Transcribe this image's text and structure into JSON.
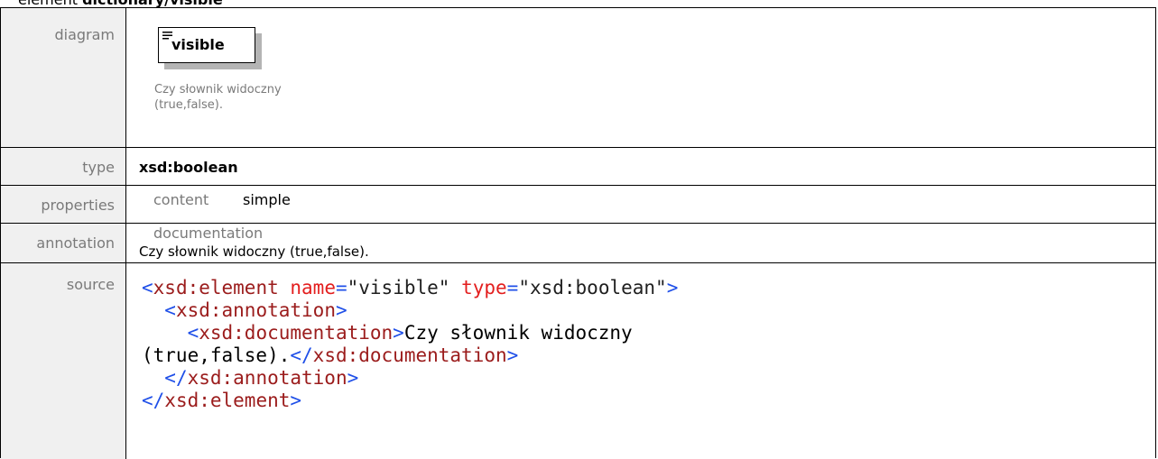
{
  "heading": {
    "prefix": "element ",
    "name": "dictionary/visible"
  },
  "rows": {
    "diagram": {
      "label": "diagram",
      "element_name": "visible",
      "doc_line1": "Czy słownik widoczny",
      "doc_line2": "(true,false)."
    },
    "type": {
      "label": "type",
      "value": "xsd:boolean"
    },
    "properties": {
      "label": "properties",
      "key": "content",
      "value": "simple"
    },
    "annotation": {
      "label": "annotation",
      "key": "documentation",
      "value": "Czy słownik widoczny (true,false)."
    },
    "source": {
      "label": "source",
      "lines": {
        "l1": {
          "open": "<",
          "tag": "xsd:element",
          "a1": "name",
          "eq1": "=",
          "v1": "\"visible\"",
          "a2": "type",
          "eq2": "=",
          "v2": "\"xsd:boolean\"",
          "close": ">"
        },
        "l2": {
          "indent": "  ",
          "open": "<",
          "tag": "xsd:annotation",
          "close": ">"
        },
        "l3": {
          "indent": "    ",
          "open": "<",
          "tag": "xsd:documentation",
          "close": ">",
          "text": "Czy słownik widoczny"
        },
        "l4": {
          "text": "(true,false).",
          "open": "</",
          "tag": "xsd:documentation",
          "close": ">"
        },
        "l5": {
          "indent": "  ",
          "open": "</",
          "tag": "xsd:annotation",
          "close": ">"
        },
        "l6": {
          "open": "</",
          "tag": "xsd:element",
          "close": ">"
        }
      }
    }
  },
  "colors": {
    "label_bg": "#f0f0f0",
    "label_text": "#7a7a7a",
    "bracket": "#1f4fe8",
    "tag": "#9b1c1c",
    "attr": "#e31e1e"
  }
}
